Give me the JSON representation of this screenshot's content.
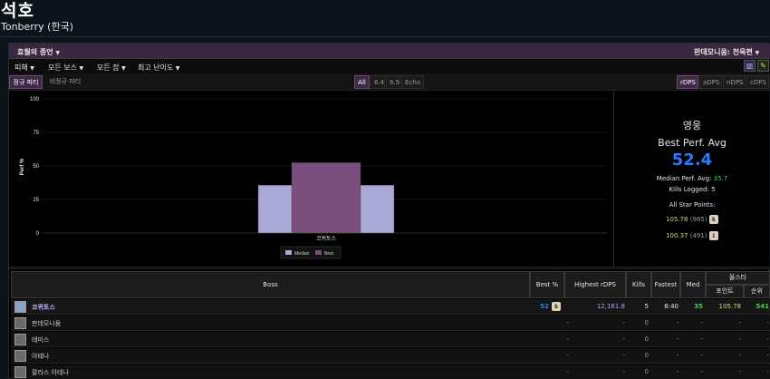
{
  "header": {
    "name": "석호",
    "server": "Tonberry (한국)"
  },
  "toolbar1": {
    "left_label": "효월의 종언",
    "right_label": "판데모니움: 천옥편"
  },
  "toolbar2": {
    "menus": [
      "피해",
      "모든 보스",
      "모든 잡",
      "최고 난이도"
    ]
  },
  "tabs": {
    "party": [
      "정규 파티",
      "비정규 파티"
    ],
    "party_selected": 0,
    "patch": [
      "All",
      "6.4",
      "6.5",
      "Echo"
    ],
    "patch_selected": 0,
    "metric": [
      "rDPS",
      "aDPS",
      "nDPS",
      "cDPS"
    ],
    "metric_selected": 0
  },
  "chart_data": {
    "type": "bar",
    "categories": [
      "코퀴토스"
    ],
    "series": [
      {
        "name": "Median",
        "values": [
          35.7
        ],
        "color": "#a9a9d8"
      },
      {
        "name": "Best",
        "values": [
          52.4
        ],
        "color": "#7a4f7e"
      }
    ],
    "ylabel": "Perf %",
    "ylim": [
      0,
      100
    ],
    "yticks": [
      0,
      25,
      50,
      75,
      100
    ],
    "legend": "bottom-center"
  },
  "summary": {
    "title": "영웅",
    "label": "Best Perf. Avg",
    "value": "52.4",
    "median_label": "Median Perf. Avg:",
    "median_value": "35.7",
    "kills_label": "Kills Logged:",
    "kills_value": "5",
    "star_label": "All Star Points:",
    "stars": [
      {
        "points": "105.78",
        "rank": "(985)"
      },
      {
        "points": "100.37",
        "rank": "(491)"
      }
    ]
  },
  "table": {
    "headers": {
      "boss": "Boss",
      "best": "Best %",
      "highest": "Highest rDPS",
      "kills": "Kills",
      "fastest": "Fastest",
      "med": "Med",
      "allstar": "올스타",
      "points": "포인트",
      "rank": "순위"
    },
    "rows": [
      {
        "boss": "코퀴토스",
        "best": "52",
        "highest": "12,161.8",
        "kills": "5",
        "fastest": "8:40",
        "med": "35",
        "points": "105.78",
        "rank": "541"
      },
      {
        "boss": "판데모니움",
        "best": "-",
        "highest": "-",
        "kills": "0",
        "fastest": "-",
        "med": "-",
        "points": "-",
        "rank": "-"
      },
      {
        "boss": "테미스",
        "best": "-",
        "highest": "-",
        "kills": "0",
        "fastest": "-",
        "med": "-",
        "points": "-",
        "rank": "-"
      },
      {
        "boss": "아테나",
        "best": "-",
        "highest": "-",
        "kills": "0",
        "fastest": "-",
        "med": "-",
        "points": "-",
        "rank": "-"
      },
      {
        "boss": "팔라스 아테나",
        "best": "-",
        "highest": "-",
        "kills": "0",
        "fastest": "-",
        "med": "-",
        "points": "-",
        "rank": "-"
      }
    ]
  },
  "colors": {
    "accent_blue": "#2c7bff",
    "green": "#44d544",
    "purple": "#3e2a47"
  }
}
